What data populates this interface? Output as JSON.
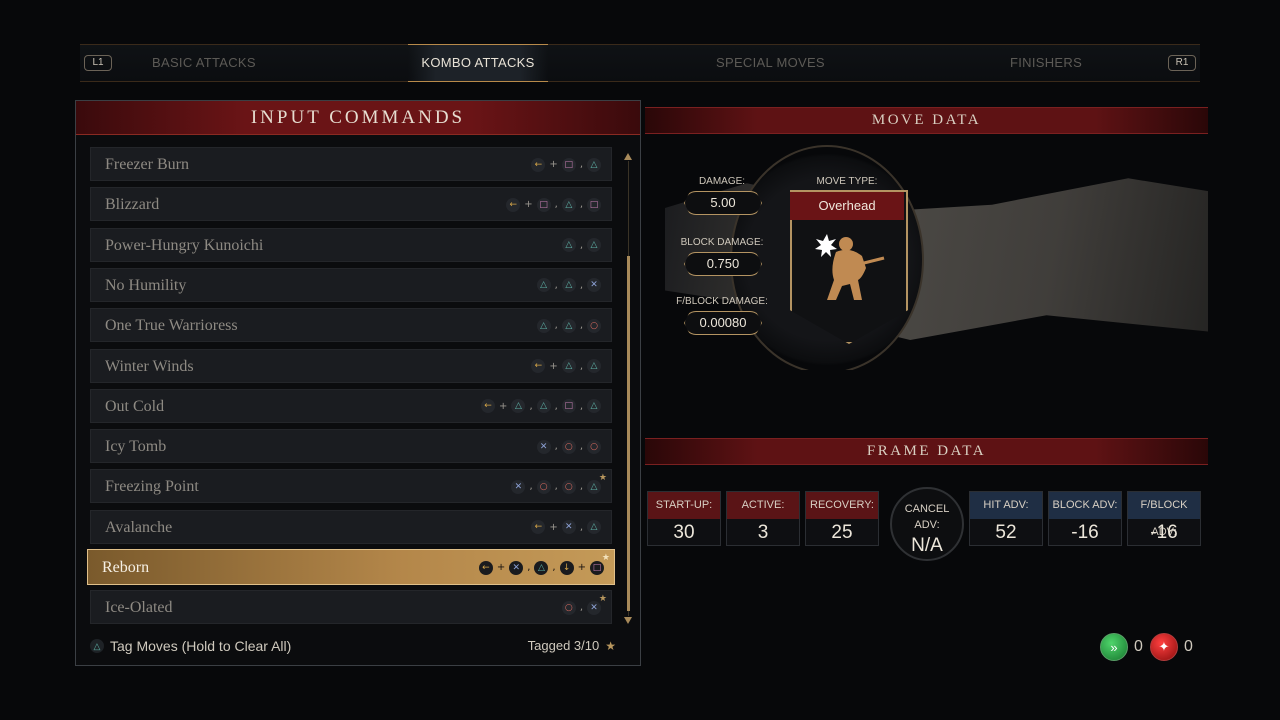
{
  "tabs": {
    "left_bumper": "L1",
    "right_bumper": "R1",
    "items": [
      {
        "label": "BASIC ATTACKS",
        "active": false
      },
      {
        "label": "KOMBO ATTACKS",
        "active": true
      },
      {
        "label": "SPECIAL MOVES",
        "active": false
      },
      {
        "label": "FINISHERS",
        "active": false
      }
    ]
  },
  "input_commands": {
    "title": "INPUT COMMANDS",
    "moves": [
      {
        "name": "Freezer Burn",
        "inputs": [
          "back",
          "+",
          "square",
          ",",
          "triangle"
        ],
        "tagged": false
      },
      {
        "name": "Blizzard",
        "inputs": [
          "back",
          "+",
          "square",
          ",",
          "triangle",
          ",",
          "square"
        ],
        "tagged": false
      },
      {
        "name": "Power-Hungry Kunoichi",
        "inputs": [
          "triangle",
          ",",
          "triangle"
        ],
        "tagged": false
      },
      {
        "name": "No Humility",
        "inputs": [
          "triangle",
          ",",
          "triangle",
          ",",
          "cross"
        ],
        "tagged": false
      },
      {
        "name": "One True Warrioress",
        "inputs": [
          "triangle",
          ",",
          "triangle",
          ",",
          "circle"
        ],
        "tagged": false
      },
      {
        "name": "Winter Winds",
        "inputs": [
          "back",
          "+",
          "triangle",
          ",",
          "triangle"
        ],
        "tagged": false
      },
      {
        "name": "Out Cold",
        "inputs": [
          "back",
          "+",
          "triangle",
          ",",
          "triangle",
          ",",
          "square",
          ",",
          "triangle"
        ],
        "tagged": false
      },
      {
        "name": "Icy Tomb",
        "inputs": [
          "cross",
          ",",
          "circle",
          ",",
          "circle"
        ],
        "tagged": false
      },
      {
        "name": "Freezing Point",
        "inputs": [
          "cross",
          ",",
          "circle",
          ",",
          "circle",
          ",",
          "triangle"
        ],
        "tagged": true
      },
      {
        "name": "Avalanche",
        "inputs": [
          "back",
          "+",
          "cross",
          ",",
          "triangle"
        ],
        "tagged": false
      },
      {
        "name": "Reborn",
        "inputs": [
          "back",
          "+",
          "cross",
          ",",
          "triangle",
          ",",
          "down",
          "+",
          "square"
        ],
        "tagged": true,
        "selected": true
      },
      {
        "name": "Ice-Olated",
        "inputs": [
          "circle",
          ",",
          "cross"
        ],
        "tagged": true
      }
    ],
    "footer_hint": "Tag Moves (Hold to Clear All)",
    "footer_tagged": "Tagged 3/10"
  },
  "move_data": {
    "title": "MOVE DATA",
    "damage_label": "DAMAGE:",
    "damage": "5.00",
    "block_damage_label": "BLOCK DAMAGE:",
    "block_damage": "0.750",
    "fblock_damage_label": "F/BLOCK DAMAGE:",
    "fblock_damage": "0.00080",
    "move_type_label": "MOVE TYPE:",
    "move_type": "Overhead"
  },
  "frame_data": {
    "title": "FRAME DATA",
    "startup_label": "START-UP:",
    "startup": "30",
    "active_label": "ACTIVE:",
    "active": "3",
    "recovery_label": "RECOVERY:",
    "recovery": "25",
    "cancel_label": "CANCEL ADV:",
    "cancel": "N/A",
    "hit_label": "HIT ADV:",
    "hit": "52",
    "block_label": "BLOCK ADV:",
    "block": "-16",
    "fblock_label": "F/BLOCK ADV:",
    "fblock": "-16"
  },
  "currency": {
    "green_count": "0",
    "red_count": "0"
  },
  "colors": {
    "accent_gold": "#b49462",
    "header_red": "#6a1416",
    "selected_row": "#b4874a"
  }
}
